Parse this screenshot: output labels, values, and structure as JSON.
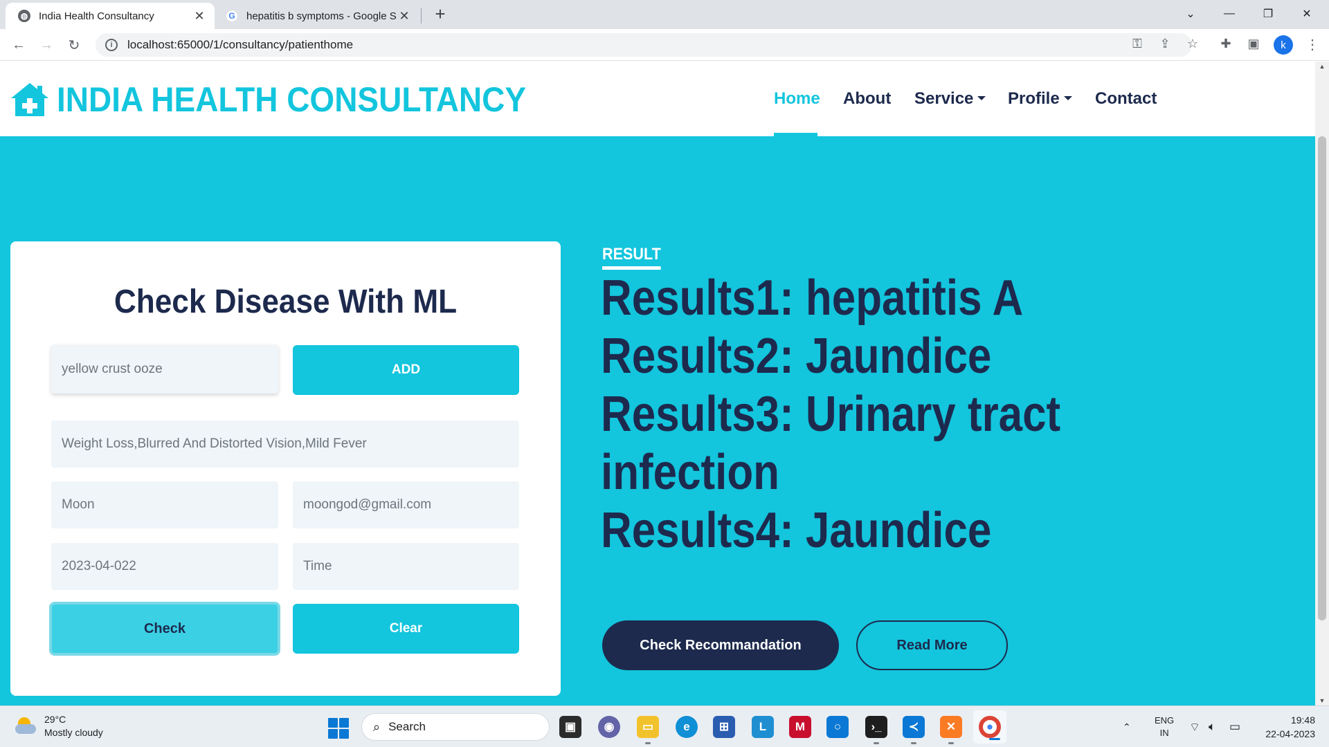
{
  "browser": {
    "tabs": [
      {
        "title": "India Health Consultancy",
        "active": true
      },
      {
        "title": "hepatitis b symptoms - Google S",
        "active": false
      }
    ],
    "url": "localhost:65000/1/consultancy/patienthome"
  },
  "site": {
    "brand": "INDIA HEALTH CONSULTANCY",
    "nav": {
      "home": "Home",
      "about": "About",
      "service": "Service",
      "profile": "Profile",
      "contact": "Contact"
    }
  },
  "form": {
    "title": "Check Disease With ML",
    "symptom_input": "yellow crust ooze",
    "add_label": "ADD",
    "symptoms_list": "Weight Loss,Blurred And Distorted Vision,Mild Fever",
    "name": "Moon",
    "email": "moongod@gmail.com",
    "date": "2023-04-022",
    "time_placeholder": "Time",
    "check_label": "Check",
    "clear_label": "Clear"
  },
  "result": {
    "tag": "RESULT",
    "lines": [
      "Results1: hepatitis A",
      "Results2: Jaundice",
      "Results3: Urinary tract",
      "infection",
      "Results4: Jaundice"
    ],
    "recommend_label": "Check Recommandation",
    "read_more_label": "Read More"
  },
  "taskbar": {
    "temp": "29°C",
    "weather": "Mostly cloudy",
    "search_label": "Search",
    "lang_top": "ENG",
    "lang_bottom": "IN",
    "time": "19:48",
    "date": "22-04-2023"
  },
  "colors": {
    "accent": "#13c5dd",
    "dark": "#1d2a4d"
  }
}
